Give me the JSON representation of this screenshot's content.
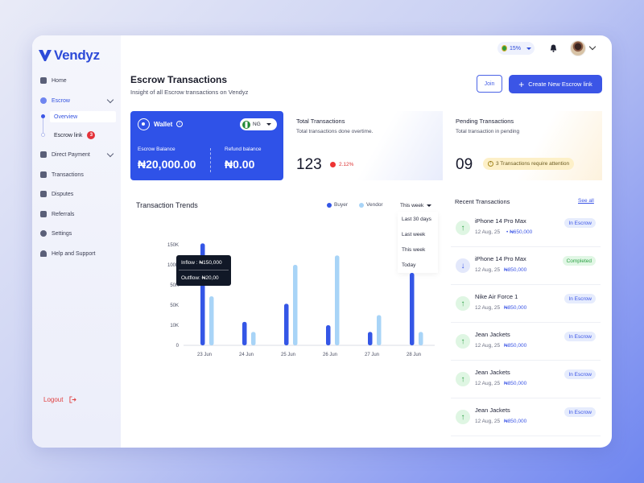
{
  "brand": {
    "name": "Vendyz"
  },
  "sidebar": {
    "items": [
      {
        "label": "Home"
      },
      {
        "label": "Escrow"
      },
      {
        "label": "Direct Payment"
      },
      {
        "label": "Transactions"
      },
      {
        "label": "Disputes"
      },
      {
        "label": "Referrals"
      },
      {
        "label": "Settings"
      },
      {
        "label": "Help and Support"
      }
    ],
    "escrow_sub": [
      {
        "label": "Overview"
      },
      {
        "label": "Escrow link",
        "badge": "3"
      }
    ],
    "logout": "Logout"
  },
  "topbar": {
    "level": "15%"
  },
  "header": {
    "title": "Escrow Transactions",
    "subtitle": "Insight of all Escrow transactions on Vendyz",
    "join_label": "Join",
    "create_label": "Create New Escrow link"
  },
  "wallet": {
    "title": "Wallet",
    "country": "NG",
    "escrow_label": "Escrow Balance",
    "escrow_value": "₦20,000.00",
    "refund_label": "Refund balance",
    "refund_value": "₦0.00"
  },
  "stats": {
    "total": {
      "title": "Total Transactions",
      "sub": "Total transactions done overtime.",
      "value": "123",
      "change": "2.12%"
    },
    "pending": {
      "title": "Pending Transactions",
      "sub": "Total transaction in pending",
      "value": "09",
      "note": "3 Transactions require attention"
    }
  },
  "trends": {
    "title": "Transaction Trends",
    "legend": [
      "Buyer",
      "Vendor"
    ],
    "period": "This week",
    "period_options": [
      "Last 30 days",
      "Last week",
      "This week",
      "Today"
    ],
    "tooltip": {
      "inflow": "Inflow : ₦150,000",
      "outflow": "Outflow: ₦20,00"
    }
  },
  "chart_data": {
    "type": "bar",
    "categories": [
      "23 Jun",
      "24 Jun",
      "25 Jun",
      "26 Jun",
      "27 Jun",
      "28 Jun"
    ],
    "y_ticks": [
      "0",
      "10K",
      "50K",
      "50K",
      "100K",
      "150K"
    ],
    "series": [
      {
        "name": "Buyer",
        "values": [
          152,
          35,
          62,
          30,
          20,
          108
        ]
      },
      {
        "name": "Vendor",
        "values": [
          73,
          20,
          120,
          134,
          45,
          20
        ]
      }
    ],
    "ylim": [
      0,
      150
    ],
    "colors": {
      "Buyer": "#3456e6",
      "Vendor": "#a8d4f7"
    }
  },
  "recent": {
    "title": "Recent Transactions",
    "see_all": "See all",
    "rows": [
      {
        "name": "iPhone 14 Pro Max",
        "date": "12 Aug, 25",
        "amount": "₦650,000",
        "status": "In Escrow",
        "dir": "up"
      },
      {
        "name": "iPhone 14 Pro Max",
        "date": "12 Aug, 25",
        "amount": "₦850,000",
        "status": "Completed",
        "dir": "down"
      },
      {
        "name": "Nike Air Force 1",
        "date": "12 Aug, 25",
        "amount": "₦850,000",
        "status": "In Escrow",
        "dir": "up"
      },
      {
        "name": "Jean Jackets",
        "date": "12 Aug, 25",
        "amount": "₦850,000",
        "status": "In Escrow",
        "dir": "up"
      },
      {
        "name": "Jean Jackets",
        "date": "12 Aug, 25",
        "amount": "₦850,000",
        "status": "In Escrow",
        "dir": "up"
      },
      {
        "name": "Jean Jackets",
        "date": "12 Aug, 25",
        "amount": "₦850,000",
        "status": "In Escrow",
        "dir": "up"
      }
    ]
  }
}
